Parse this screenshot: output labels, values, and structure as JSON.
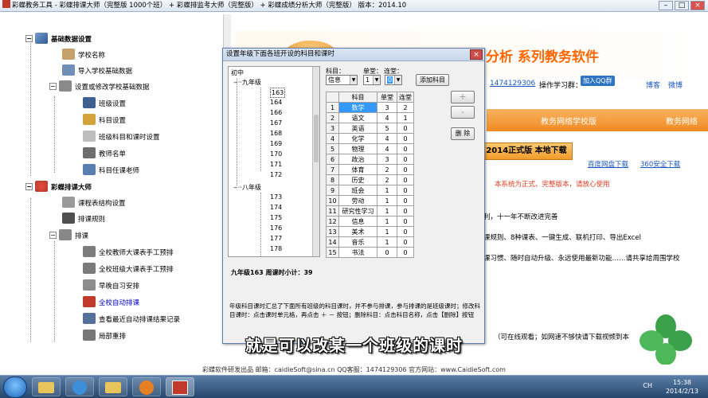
{
  "window": {
    "title": "彩蝶教务工具 - 彩蝶排课大师（完整版 1000个班） + 彩蝶排监考大师（完整版） + 彩蝶成绩分析大师（完整版）  版本：2014.10"
  },
  "tree": {
    "sections": [
      {
        "label": "基础数据设置",
        "items": [
          "学校名称",
          "导入学校基础数据",
          "设置或修改学校基础数据",
          "班级设置",
          "科目设置",
          "班级科目和课时设置",
          "教师名单",
          "科目任课老师"
        ]
      },
      {
        "label": "彩蝶排课大师",
        "items": [
          "课程表结构设置",
          "排课规则",
          "排课",
          "全校教师大课表手工预排",
          "全校班级大课表手工预排",
          "早晚自习安排",
          "全校自动排课",
          "查看最近自动排课结果记录",
          "局部重排"
        ]
      }
    ]
  },
  "web": {
    "banner_title": "分析 系列教务软件",
    "contact_tail": "1474129306",
    "tutorial_label": "操作学习群：",
    "join_qq": "加入QQ群",
    "weibo1": "博客",
    "weibo2": "微博",
    "tab_edu": "教务网络学校版",
    "tab_edu2": "教务网络",
    "tab_left": "学",
    "download_btn": "2014正式版 本地下载",
    "download_baidu": "百度网盘下载",
    "download_360": "360安全下载",
    "notice": "本系统为正式、完整版本，请放心使用",
    "line1": "利，十一年不断改进完善",
    "line2": "课规则、8种课表、一键生成、联机打印、导出Excel",
    "line3": "课习惯、随时自动升级、永远使用最新功能……请共享给周围学校",
    "line4": "（可在线观看；如网速不够快请下载视频到本"
  },
  "dialog": {
    "title": "设置年级下面各班开设的科目和课时",
    "tree_root": "初中",
    "grades": [
      {
        "name": "九年级",
        "classes": [
          "163",
          "164",
          "166",
          "167",
          "168",
          "169",
          "170",
          "171",
          "172"
        ]
      },
      {
        "name": "八年级",
        "classes": [
          "173",
          "174",
          "175",
          "176",
          "177",
          "178",
          "179"
        ]
      }
    ],
    "subject_label": "科目：",
    "unit_label": "单堂：",
    "double_label": "连堂：",
    "subject_value": "信息",
    "unit_value": "1",
    "double_value": "0",
    "add_subject": "添加科目",
    "plus": "+",
    "minus": "-",
    "delete": "删 除",
    "columns": [
      "科目",
      "单堂",
      "连堂"
    ],
    "rows": [
      [
        "1",
        "数学",
        "3",
        "2"
      ],
      [
        "2",
        "语文",
        "4",
        "1"
      ],
      [
        "3",
        "英语",
        "5",
        "0"
      ],
      [
        "4",
        "化学",
        "4",
        "0"
      ],
      [
        "5",
        "物理",
        "4",
        "0"
      ],
      [
        "6",
        "政治",
        "3",
        "0"
      ],
      [
        "7",
        "体育",
        "2",
        "0"
      ],
      [
        "8",
        "历史",
        "2",
        "0"
      ],
      [
        "9",
        "班会",
        "1",
        "0"
      ],
      [
        "10",
        "劳动",
        "1",
        "0"
      ],
      [
        "11",
        "研究性学习",
        "1",
        "0"
      ],
      [
        "12",
        "信息",
        "1",
        "0"
      ],
      [
        "13",
        "美术",
        "1",
        "0"
      ],
      [
        "14",
        "音乐",
        "1",
        "0"
      ],
      [
        "15",
        "书法",
        "0",
        "0"
      ]
    ],
    "week_hours": "九年级163 周课时小计：39",
    "note": "年级科目课时汇总了下面所有班级的科目课时，并不参与排课，参与排课的是班级课时；修改科目课时：点击课时单元格，再点击 ＋ － 按钮；删除科目：点击科目名称，点击【删除】按钮"
  },
  "subtitle": "就是可以改某一个班级的课时",
  "footer": "彩蝶软件研发出品    邮箱：caidieSoft@sina.cn    QQ客服：1474129306    官方网站：www.CaidieSoft.com",
  "taskbar": {
    "time": "15:38",
    "date": "2014/2/13",
    "ime": "CH"
  },
  "colors": {
    "accent_orange": "#ff6600",
    "banner_orange": "#f28c28",
    "selection_blue": "#3399ff"
  }
}
